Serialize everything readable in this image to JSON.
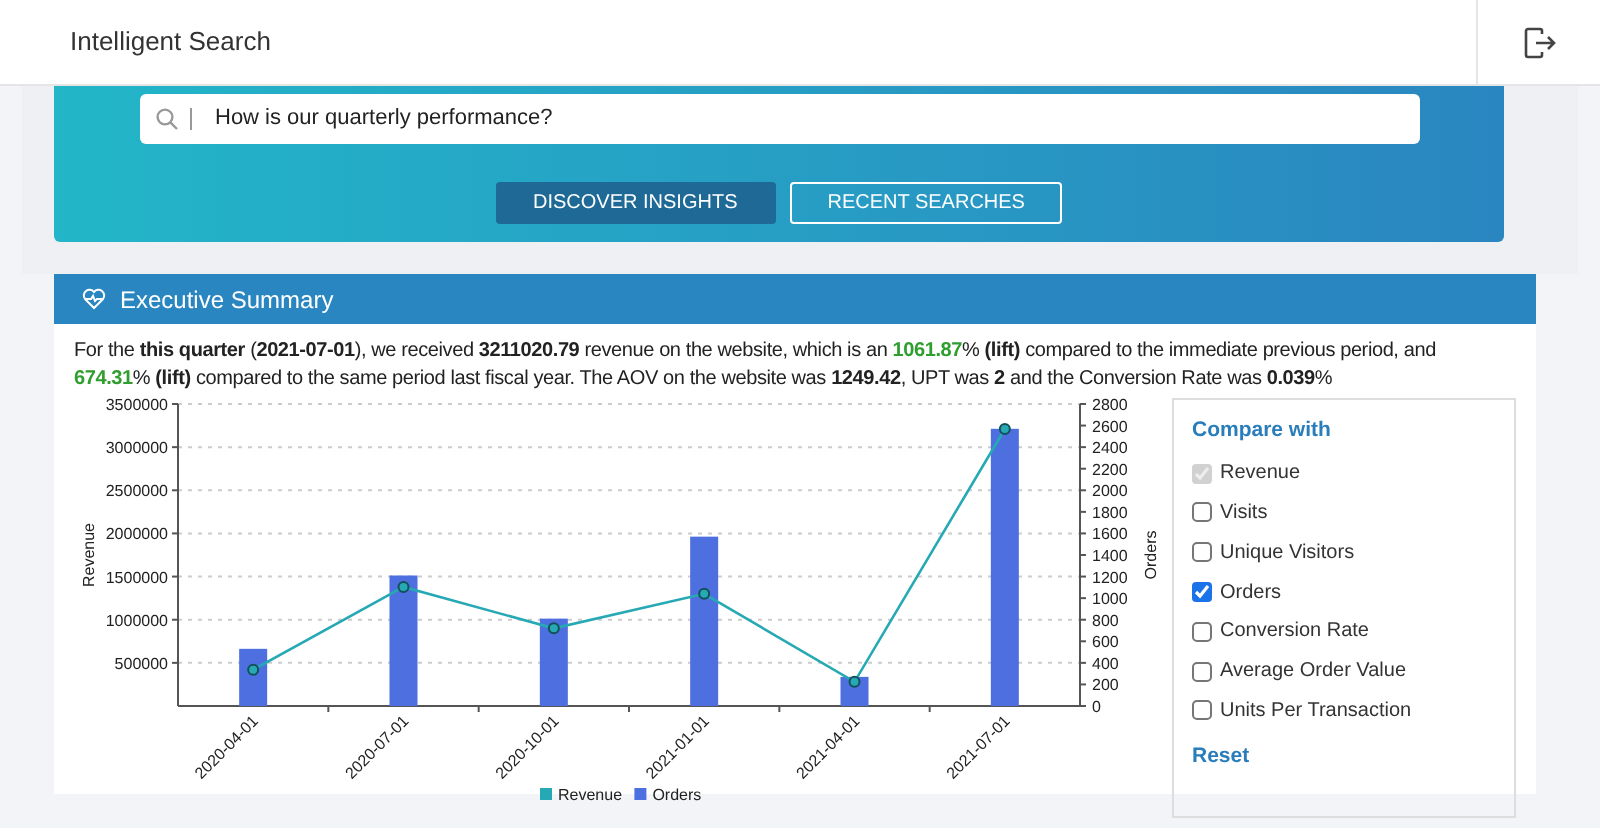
{
  "header": {
    "title": "Intelligent Search"
  },
  "search": {
    "value": "How is our quarterly performance?"
  },
  "actions": [
    {
      "label": "DISCOVER INSIGHTS",
      "selected": true
    },
    {
      "label": "RECENT SEARCHES",
      "selected": false
    }
  ],
  "summary": {
    "title": "Executive Summary",
    "text": [
      {
        "kind": "plain",
        "text": "For the "
      },
      {
        "kind": "bold",
        "text": "this quarter"
      },
      {
        "kind": "plain",
        "text": " ("
      },
      {
        "kind": "bold",
        "text": "2021-07-01"
      },
      {
        "kind": "plain",
        "text": "), we received "
      },
      {
        "kind": "bold",
        "text": "3211020.79"
      },
      {
        "kind": "plain",
        "text": " revenue on the website, which is an "
      },
      {
        "kind": "positive",
        "text": "1061.87"
      },
      {
        "kind": "plain",
        "text": "% "
      },
      {
        "kind": "bold",
        "text": "(lift)"
      },
      {
        "kind": "plain",
        "text": " compared to the immediate previous period, and "
      },
      {
        "kind": "positive",
        "text": "674.31"
      },
      {
        "kind": "plain",
        "text": "% "
      },
      {
        "kind": "bold",
        "text": "(lift)"
      },
      {
        "kind": "plain",
        "text": " compared to the same period last fiscal year. The AOV on the website was "
      },
      {
        "kind": "bold",
        "text": "1249.42"
      },
      {
        "kind": "plain",
        "text": ", UPT was "
      },
      {
        "kind": "bold",
        "text": "2"
      },
      {
        "kind": "plain",
        "text": " and the Conversion Rate was "
      },
      {
        "kind": "bold",
        "text": "0.039"
      },
      {
        "kind": "plain",
        "text": "%"
      }
    ],
    "chart_data": {
      "type": "bar",
      "ylabel": "Revenue",
      "y2label": "Orders",
      "categories": [
        "2020-04-01",
        "2020-07-01",
        "2020-10-01",
        "2021-01-01",
        "2021-04-01",
        "2021-07-01"
      ],
      "series": [
        {
          "name": "Revenue",
          "color": "#26a9b4",
          "type": "line",
          "marker": "circle",
          "axis": "y",
          "values": [
            420000,
            1380000,
            900000,
            1300000,
            280000,
            3210000
          ]
        },
        {
          "name": "Orders",
          "color": "#4d6fe0",
          "axis": "y2",
          "values": [
            530,
            1210,
            810,
            1570,
            270,
            2570
          ]
        }
      ],
      "grid": true,
      "legend": true,
      "ylim": [
        0,
        3500000
      ],
      "yticks": [
        500000,
        1000000,
        1500000,
        2000000,
        2500000,
        3000000,
        3500000
      ],
      "y2lim": [
        0,
        2800
      ],
      "y2ticks": [
        0,
        200,
        400,
        600,
        800,
        1000,
        1200,
        1400,
        1600,
        1800,
        2000,
        2200,
        2400,
        2600,
        2800
      ]
    },
    "compare": {
      "title": "Compare with",
      "options": [
        {
          "label": "Revenue",
          "checked": true,
          "disabled": true
        },
        {
          "label": "Visits",
          "checked": false,
          "disabled": false
        },
        {
          "label": "Unique Visitors",
          "checked": false,
          "disabled": false
        },
        {
          "label": "Orders",
          "checked": true,
          "disabled": false
        },
        {
          "label": "Conversion Rate",
          "checked": false,
          "disabled": false
        },
        {
          "label": "Average Order Value",
          "checked": false,
          "disabled": false
        },
        {
          "label": "Units Per Transaction",
          "checked": false,
          "disabled": false
        }
      ],
      "reset": "Reset"
    }
  }
}
